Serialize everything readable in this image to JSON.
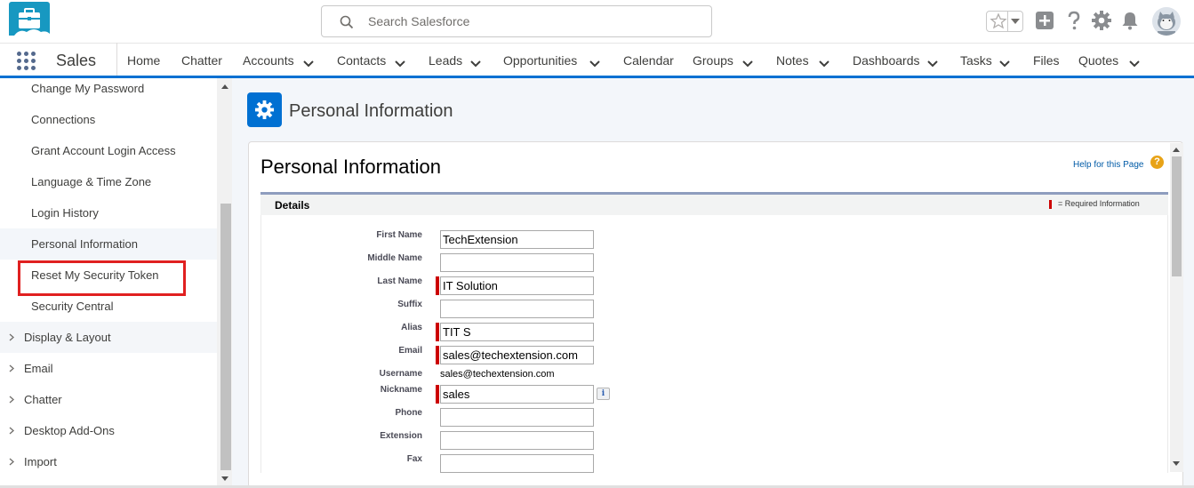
{
  "header": {
    "search_placeholder": "Search Salesforce",
    "icons": [
      "briefcase-logo-icon",
      "search-icon",
      "favorites-star-icon",
      "global-actions-plus-icon",
      "help-icon",
      "setup-gear-icon",
      "notifications-bell-icon",
      "user-avatar-icon"
    ]
  },
  "nav": {
    "app_name": "Sales",
    "items": [
      {
        "label": "Home"
      },
      {
        "label": "Chatter"
      },
      {
        "label": "Accounts"
      },
      {
        "label": "Contacts"
      },
      {
        "label": "Leads"
      },
      {
        "label": "Opportunities"
      },
      {
        "label": "Calendar"
      },
      {
        "label": "Groups"
      },
      {
        "label": "Notes"
      },
      {
        "label": "Dashboards"
      },
      {
        "label": "Tasks"
      },
      {
        "label": "Files"
      },
      {
        "label": "Quotes"
      }
    ]
  },
  "sidebar": {
    "sub_items": [
      {
        "label": "Change My Password"
      },
      {
        "label": "Connections"
      },
      {
        "label": "Grant Account Login Access"
      },
      {
        "label": "Language & Time Zone"
      },
      {
        "label": "Login History"
      },
      {
        "label": "Personal Information"
      },
      {
        "label": "Reset My Security Token"
      },
      {
        "label": "Security Central"
      }
    ],
    "groups": [
      {
        "label": "Display & Layout"
      },
      {
        "label": "Email"
      },
      {
        "label": "Chatter"
      },
      {
        "label": "Desktop Add-Ons"
      },
      {
        "label": "Import"
      }
    ]
  },
  "page": {
    "header_title": "Personal Information",
    "heading": "Personal Information",
    "help_link": "Help for this Page",
    "help_icon_glyph": "?",
    "section_title": "Details",
    "required_legend": "= Required Information"
  },
  "form": {
    "first_name_label": "First Name",
    "first_name_value": "TechExtension",
    "middle_name_label": "Middle Name",
    "middle_name_value": "",
    "last_name_label": "Last Name",
    "last_name_value": "IT Solution",
    "suffix_label": "Suffix",
    "suffix_value": "",
    "alias_label": "Alias",
    "alias_value": "TIT S",
    "email_label": "Email",
    "email_value": "sales@techextension.com",
    "username_label": "Username",
    "username_value": "sales@techextension.com",
    "nickname_label": "Nickname",
    "nickname_value": "sales",
    "nickname_info": "i",
    "phone_label": "Phone",
    "phone_value": "",
    "extension_label": "Extension",
    "extension_value": "",
    "fax_label": "Fax",
    "fax_value": ""
  },
  "colors": {
    "brand_blue": "#0070d2",
    "required_red": "#cc0000",
    "highlight_box": "#e02020"
  }
}
